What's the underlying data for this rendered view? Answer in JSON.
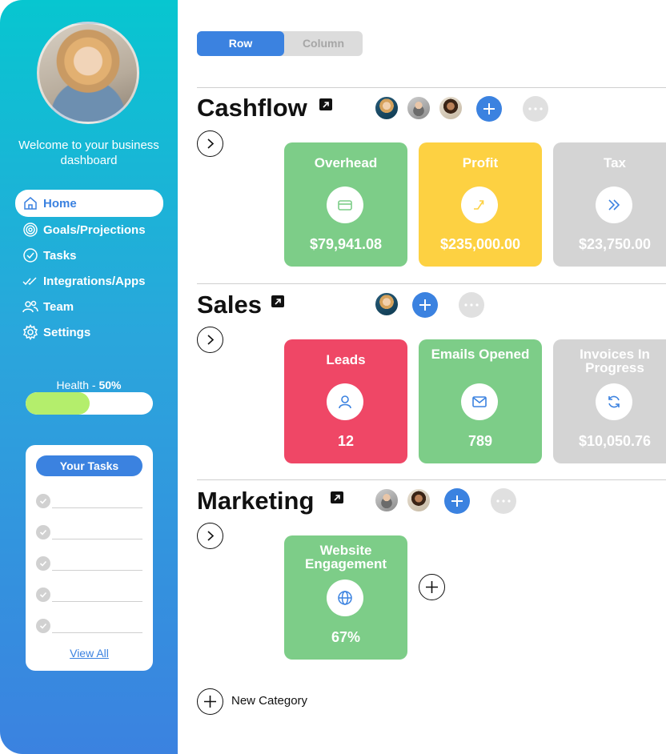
{
  "sidebar": {
    "welcome": "Welcome to your business dashboard",
    "nav": [
      {
        "label": "Home",
        "icon": "home-icon",
        "active": true
      },
      {
        "label": "Goals/Projections",
        "icon": "target-icon"
      },
      {
        "label": "Tasks",
        "icon": "check-circle-icon"
      },
      {
        "label": "Integrations/Apps",
        "icon": "double-check-icon"
      },
      {
        "label": "Team",
        "icon": "team-icon"
      },
      {
        "label": "Settings",
        "icon": "gear-icon"
      }
    ],
    "health": {
      "label": "Health - ",
      "value": "50%",
      "fraction": 0.5
    },
    "tasks": {
      "title": "Your Tasks",
      "count": 5,
      "view_all": "View All"
    }
  },
  "toggle": {
    "row": "Row",
    "column": "Column",
    "selected": "Row"
  },
  "colors": {
    "accent": "#3b82e0",
    "green": "#7dcd88",
    "yellow": "#fdd142",
    "grey": "#d4d4d4",
    "red": "#ef4766",
    "health": "#b4ee6c"
  },
  "sections": [
    {
      "title": "Cashflow",
      "cards": [
        {
          "title": "Overhead",
          "value": "$79,941.08",
          "icon": "card-icon",
          "color": "green"
        },
        {
          "title": "Profit",
          "value": "$235,000.00",
          "icon": "trend-up-icon",
          "color": "yellow"
        },
        {
          "title": "Tax",
          "value": "$23,750.00",
          "icon": "double-chevron-icon",
          "color": "grey"
        }
      ]
    },
    {
      "title": "Sales",
      "cards": [
        {
          "title": "Leads",
          "value": "12",
          "icon": "user-icon",
          "color": "red"
        },
        {
          "title": "Emails Opened",
          "value": "789",
          "icon": "mail-icon",
          "color": "green"
        },
        {
          "title": "Invoices In Progress",
          "value": "$10,050.76",
          "icon": "refresh-icon",
          "color": "grey"
        }
      ]
    },
    {
      "title": "Marketing",
      "cards": [
        {
          "title": "Website Engagement",
          "value": "67%",
          "icon": "globe-icon",
          "color": "green"
        }
      ]
    }
  ],
  "new_category": "New Category"
}
